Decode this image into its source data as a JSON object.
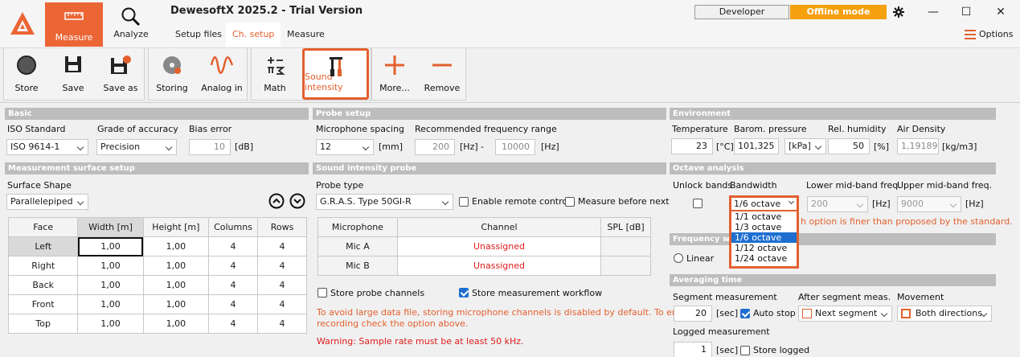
{
  "header": {
    "app_title": "DewesoftX 2025.2 - Trial Version",
    "measure_tab": "Measure",
    "analyze_tab": "Analyze",
    "subtabs": [
      "Setup files",
      "Ch. setup",
      "Measure"
    ],
    "developer": "Developer",
    "offline_mode": "Offline mode",
    "options": "Options"
  },
  "toolbar": {
    "store": "Store",
    "save": "Save",
    "save_as": "Save as",
    "storing": "Storing",
    "analog_in": "Analog in",
    "math": "Math",
    "sound_intensity": "Sound intensity",
    "more": "More...",
    "remove": "Remove"
  },
  "basic": {
    "title": "Basic",
    "iso_label": "ISO Standard",
    "iso_value": "ISO 9614-1",
    "grade_label": "Grade of accuracy",
    "grade_value": "Precision",
    "bias_label": "Bias error",
    "bias_value": "10",
    "bias_unit": "[dB]"
  },
  "probe_setup": {
    "title": "Probe setup",
    "spacing_label": "Microphone spacing",
    "spacing_value": "12",
    "spacing_unit": "[mm]",
    "range_label": "Recommended frequency range",
    "range_from": "200",
    "range_from_unit": "[Hz]",
    "dash": "-",
    "range_to": "10000",
    "range_to_unit": "[Hz]"
  },
  "environment": {
    "title": "Environment",
    "temp_label": "Temperature",
    "temp_value": "23",
    "temp_unit": "[°C]",
    "press_label": "Barom. pressure",
    "press_value": "101,325",
    "press_unit": "[kPa]",
    "hum_label": "Rel. humidity",
    "hum_value": "50",
    "hum_unit": "[%]",
    "dens_label": "Air Density",
    "dens_value": "1,19189",
    "dens_unit": "[kg/m3]"
  },
  "surface": {
    "title": "Measurement surface setup",
    "shape_label": "Surface Shape",
    "shape_value": "Parallelepiped",
    "headers": [
      "Face",
      "Width [m]",
      "Height [m]",
      "Columns",
      "Rows"
    ],
    "rows": [
      [
        "Left",
        "1,00",
        "1,00",
        "4",
        "4"
      ],
      [
        "Right",
        "1,00",
        "1,00",
        "4",
        "4"
      ],
      [
        "Back",
        "1,00",
        "1,00",
        "4",
        "4"
      ],
      [
        "Front",
        "1,00",
        "1,00",
        "4",
        "4"
      ],
      [
        "Top",
        "1,00",
        "1,00",
        "4",
        "4"
      ]
    ]
  },
  "probe": {
    "title": "Sound intensity probe",
    "type_label": "Probe type",
    "type_value": "G.R.A.S. Type 50GI-R",
    "remote_label": "Enable remote control",
    "before_label": "Measure before next",
    "headers": [
      "Microphone",
      "Channel",
      "SPL [dB]"
    ],
    "rows": [
      [
        "Mic A",
        "Unassigned",
        ""
      ],
      [
        "Mic B",
        "Unassigned",
        ""
      ]
    ],
    "store_probe": "Store probe channels",
    "store_workflow": "Store measurement workflow",
    "info_line1": "To avoid large data file, storing microphone channels is disabled by default. To enable",
    "info_line2": "recording check the option above.",
    "warning": "Warning: Sample rate must be at least 50 kHz."
  },
  "octave": {
    "title": "Octave analysis",
    "unlock_label": "Unlock bands",
    "bw_label": "Bandwidth",
    "bw_value": "1/6 octave",
    "lower_label": "Lower mid-band freq.",
    "lower_value": "200",
    "lower_unit": "[Hz]",
    "upper_label": "Upper mid-band freq.",
    "upper_value": "9000",
    "upper_unit": "[Hz]",
    "note": "h option is finer than proposed by the standard.",
    "options": [
      "1/1 octave",
      "1/3 octave",
      "1/6 octave",
      "1/12 octave",
      "1/24 octave"
    ],
    "selected_index": 2
  },
  "frequency": {
    "title": "Frequency we",
    "linear": "Linear"
  },
  "averaging": {
    "title": "Averaging time",
    "seg_label": "Segment measurement",
    "seg_value": "20",
    "seg_unit": "[sec]",
    "autostop": "Auto stop",
    "after_label": "After segment meas.",
    "after_value": "Next segment",
    "move_label": "Movement",
    "move_value": "Both directions",
    "logged_label": "Logged measurement",
    "logged_value": "1",
    "logged_unit": "[sec]",
    "store_logged": "Store logged"
  }
}
